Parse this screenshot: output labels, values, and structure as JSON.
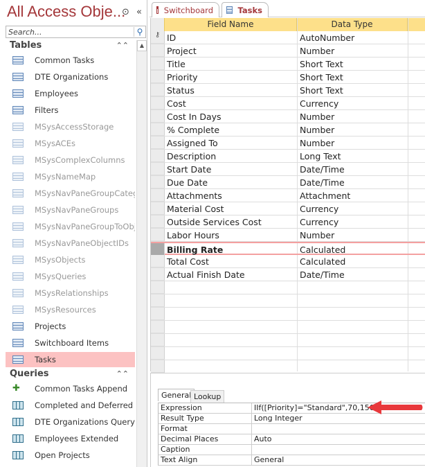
{
  "nav": {
    "title": "All Access Obje...",
    "menu_icon": "circle-chevron-down-icon",
    "collapse_icon": "double-chevron-left-icon",
    "search_placeholder": "Search...",
    "groups": [
      {
        "label": "Tables",
        "items": [
          {
            "label": "Common Tasks",
            "icon": "table-icon",
            "system": false
          },
          {
            "label": "DTE Organizations",
            "icon": "table-icon",
            "system": false
          },
          {
            "label": "Employees",
            "icon": "table-icon",
            "system": false
          },
          {
            "label": "Filters",
            "icon": "table-icon",
            "system": false
          },
          {
            "label": "MSysAccessStorage",
            "icon": "table-icon",
            "system": true
          },
          {
            "label": "MSysACEs",
            "icon": "table-icon",
            "system": true
          },
          {
            "label": "MSysComplexColumns",
            "icon": "table-icon",
            "system": true
          },
          {
            "label": "MSysNameMap",
            "icon": "table-icon",
            "system": true
          },
          {
            "label": "MSysNavPaneGroupCateg...",
            "icon": "table-icon",
            "system": true
          },
          {
            "label": "MSysNavPaneGroups",
            "icon": "table-icon",
            "system": true
          },
          {
            "label": "MSysNavPaneGroupToObj...",
            "icon": "table-icon",
            "system": true
          },
          {
            "label": "MSysNavPaneObjectIDs",
            "icon": "table-icon",
            "system": true
          },
          {
            "label": "MSysObjects",
            "icon": "table-icon",
            "system": true
          },
          {
            "label": "MSysQueries",
            "icon": "table-icon",
            "system": true
          },
          {
            "label": "MSysRelationships",
            "icon": "table-icon",
            "system": true
          },
          {
            "label": "MSysResources",
            "icon": "table-icon",
            "system": true
          },
          {
            "label": "Projects",
            "icon": "table-icon",
            "system": false
          },
          {
            "label": "Switchboard Items",
            "icon": "table-icon",
            "system": false
          },
          {
            "label": "Tasks",
            "icon": "table-icon",
            "system": false,
            "selected": true
          }
        ]
      },
      {
        "label": "Queries",
        "items": [
          {
            "label": "Common Tasks Append",
            "icon": "append-query-icon"
          },
          {
            "label": "Completed and Deferred ...",
            "icon": "query-icon"
          },
          {
            "label": "DTE Organizations Query",
            "icon": "query-icon"
          },
          {
            "label": "Employees Extended",
            "icon": "query-icon"
          },
          {
            "label": "Open Projects",
            "icon": "query-icon"
          }
        ]
      }
    ]
  },
  "tabs": [
    {
      "label": "Switchboard",
      "icon": "form-icon"
    },
    {
      "label": "Tasks",
      "icon": "table-icon",
      "active": true
    }
  ],
  "grid": {
    "headers": [
      "Field Name",
      "Data Type",
      ""
    ],
    "rows": [
      {
        "field": "ID",
        "type": "AutoNumber",
        "primary_key": true
      },
      {
        "field": "Project",
        "type": "Number"
      },
      {
        "field": "Title",
        "type": "Short Text"
      },
      {
        "field": "Priority",
        "type": "Short Text"
      },
      {
        "field": "Status",
        "type": "Short Text"
      },
      {
        "field": "Cost",
        "type": "Currency"
      },
      {
        "field": "Cost In Days",
        "type": "Number"
      },
      {
        "field": "% Complete",
        "type": "Number"
      },
      {
        "field": "Assigned To",
        "type": "Number"
      },
      {
        "field": "Description",
        "type": "Long Text"
      },
      {
        "field": "Start Date",
        "type": "Date/Time"
      },
      {
        "field": "Due Date",
        "type": "Date/Time"
      },
      {
        "field": "Attachments",
        "type": "Attachment"
      },
      {
        "field": "Material Cost",
        "type": "Currency"
      },
      {
        "field": "Outside Services Cost",
        "type": "Currency"
      },
      {
        "field": "Labor Hours",
        "type": "Number"
      },
      {
        "field": "Billing Rate",
        "type": "Calculated",
        "selected": true
      },
      {
        "field": "Total Cost",
        "type": "Calculated"
      },
      {
        "field": "Actual Finish Date",
        "type": "Date/Time"
      }
    ]
  },
  "properties": {
    "tabs": [
      "General",
      "Lookup"
    ],
    "active_tab": "General",
    "rows": [
      {
        "label": "Expression",
        "value": "IIf([Priority]=\"Standard\",70,150)"
      },
      {
        "label": "Result Type",
        "value": "Long Integer"
      },
      {
        "label": "Format",
        "value": ""
      },
      {
        "label": "Decimal Places",
        "value": "Auto"
      },
      {
        "label": "Caption",
        "value": ""
      },
      {
        "label": "Text Align",
        "value": "General"
      }
    ]
  },
  "colors": {
    "accent": "#a4373a",
    "header": "#fde08a",
    "selection": "#fcc2c2",
    "arrow": "#e8383b"
  }
}
